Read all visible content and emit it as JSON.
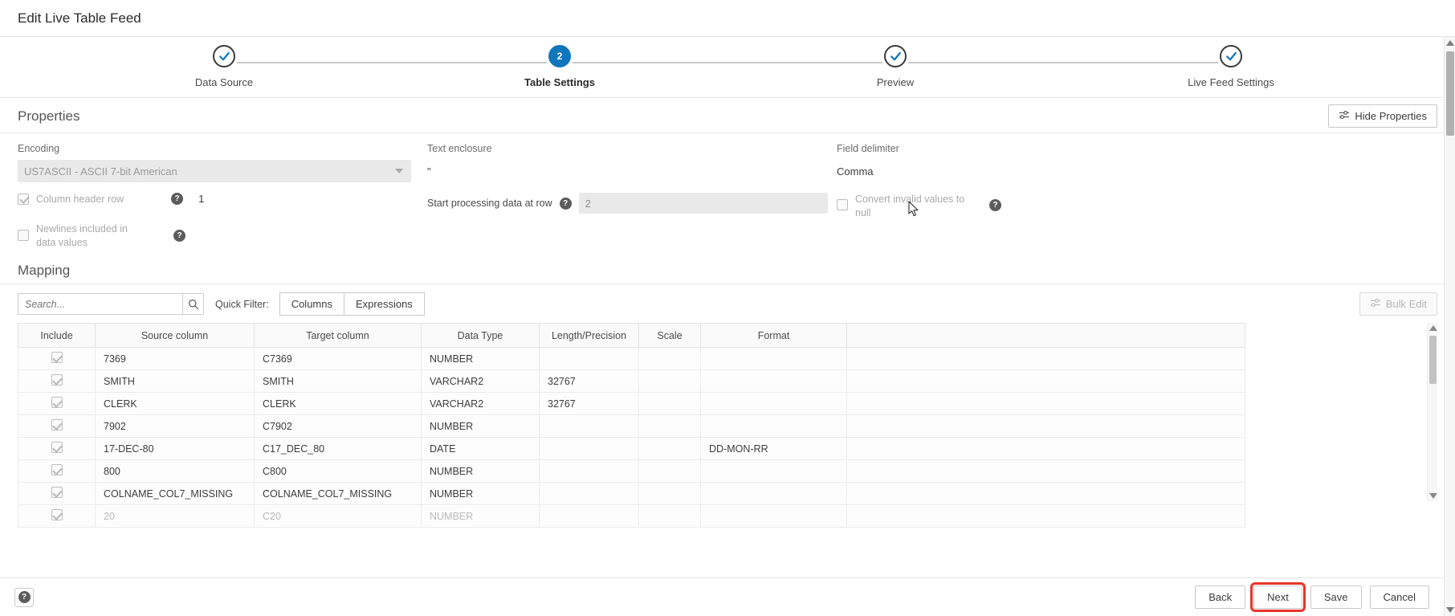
{
  "window": {
    "title": "Edit Live Table Feed"
  },
  "wizard": {
    "steps": [
      {
        "label": "Data Source",
        "state": "done",
        "marker": "check"
      },
      {
        "label": "Table Settings",
        "state": "current",
        "marker": "2"
      },
      {
        "label": "Preview",
        "state": "done",
        "marker": "check"
      },
      {
        "label": "Live Feed Settings",
        "state": "done",
        "marker": "check"
      }
    ]
  },
  "properties": {
    "heading": "Properties",
    "hide_properties_label": "Hide Properties",
    "encoding": {
      "label": "Encoding",
      "value": "US7ASCII - ASCII 7-bit American"
    },
    "text_enclosure": {
      "label": "Text enclosure",
      "value": "\""
    },
    "field_delimiter": {
      "label": "Field delimiter",
      "value": "Comma"
    },
    "column_header_row": {
      "label": "Column header row",
      "checked": "true",
      "row_number": "1",
      "help": "?"
    },
    "start_processing_row": {
      "label": "Start processing data at row",
      "value": "2",
      "help": "?"
    },
    "convert_invalid": {
      "label": "Convert invalid values to null",
      "checked": "false",
      "help": "?"
    },
    "newlines_included": {
      "label": "Newlines included in data values",
      "checked": "false",
      "help": "?"
    }
  },
  "mapping": {
    "heading": "Mapping",
    "search": {
      "placeholder": "Search...",
      "value": ""
    },
    "quick_filter_label": "Quick Filter:",
    "quick_filter_options": [
      "Columns",
      "Expressions"
    ],
    "bulk_edit_label": "Bulk Edit",
    "table": {
      "columns": [
        "Include",
        "Source column",
        "Target column",
        "Data Type",
        "Length/Precision",
        "Scale",
        "Format",
        ""
      ],
      "rows": [
        {
          "include": "true",
          "source": "7369",
          "target": "C7369",
          "type": "NUMBER",
          "length": "",
          "scale": "",
          "format": ""
        },
        {
          "include": "true",
          "source": "SMITH",
          "target": "SMITH",
          "type": "VARCHAR2",
          "length": "32767",
          "scale": "",
          "format": ""
        },
        {
          "include": "true",
          "source": "CLERK",
          "target": "CLERK",
          "type": "VARCHAR2",
          "length": "32767",
          "scale": "",
          "format": ""
        },
        {
          "include": "true",
          "source": "7902",
          "target": "C7902",
          "type": "NUMBER",
          "length": "",
          "scale": "",
          "format": ""
        },
        {
          "include": "true",
          "source": "17-DEC-80",
          "target": "C17_DEC_80",
          "type": "DATE",
          "length": "",
          "scale": "",
          "format": "DD-MON-RR"
        },
        {
          "include": "true",
          "source": "800",
          "target": "C800",
          "type": "NUMBER",
          "length": "",
          "scale": "",
          "format": ""
        },
        {
          "include": "true",
          "source": "COLNAME_COL7_MISSING",
          "target": "COLNAME_COL7_MISSING",
          "type": "NUMBER",
          "length": "",
          "scale": "",
          "format": ""
        },
        {
          "include": "true",
          "source": "20",
          "target": "C20",
          "type": "NUMBER",
          "length": "",
          "scale": "",
          "format": ""
        }
      ]
    }
  },
  "footer": {
    "help_label": "?",
    "buttons": [
      {
        "label": "Back",
        "highlighted": "false"
      },
      {
        "label": "Next",
        "highlighted": "true"
      },
      {
        "label": "Save",
        "highlighted": "false"
      },
      {
        "label": "Cancel",
        "highlighted": "false"
      }
    ]
  },
  "colors": {
    "accent": "#1076bc",
    "highlight": "#e8342a",
    "text": "#3c3c3c",
    "muted": "#a9a9a9"
  }
}
